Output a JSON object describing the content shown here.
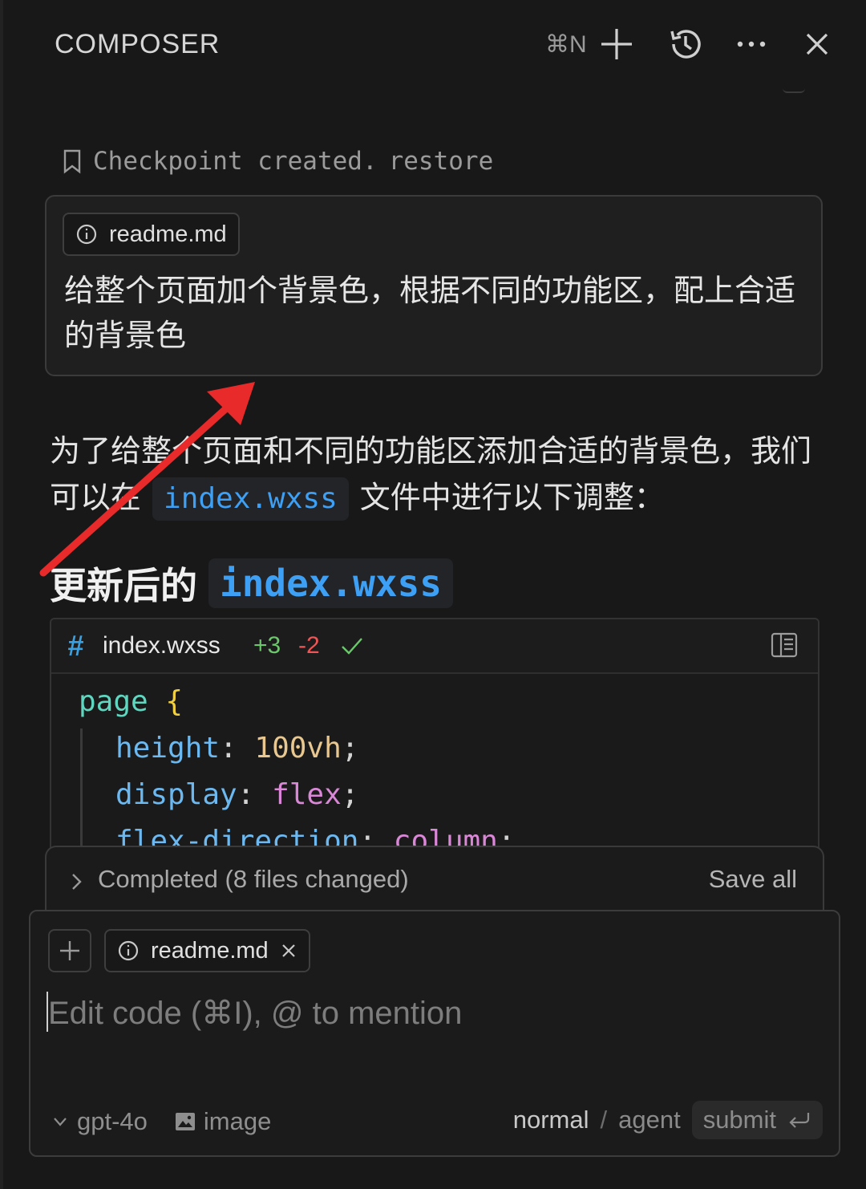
{
  "header": {
    "title": "COMPOSER",
    "shortcut": "⌘N"
  },
  "checkpoint": {
    "text": "Checkpoint created.",
    "restore": "restore"
  },
  "user_message": {
    "attachment": "readme.md",
    "text": "给整个页面加个背景色，根据不同的功能区，配上合适的背景色"
  },
  "assistant": {
    "para_before": "为了给整个页面和不同的功能区添加合适的背景色，我们可以在",
    "para_code": "index.wxss",
    "para_after": "文件中进行以下调整：",
    "heading_text": "更新后的",
    "heading_code": "index.wxss"
  },
  "code_block": {
    "lang_icon": "#",
    "filename": "index.wxss",
    "additions": "+3",
    "deletions": "-2",
    "lines": [
      {
        "sel": "page",
        "brace": "{"
      },
      {
        "prop": "height",
        "value": "100vh",
        "kind": "num"
      },
      {
        "prop": "display",
        "value": "flex",
        "kind": "kw"
      },
      {
        "prop": "flex-direction",
        "value": "column",
        "kind": "kw"
      }
    ]
  },
  "status_bar": {
    "text": "Completed (8 files changed)",
    "action": "Save all"
  },
  "input": {
    "attachment": "readme.md",
    "placeholder": "Edit code (⌘I), @ to mention",
    "model": "gpt-4o",
    "image_label": "image",
    "mode_normal": "normal",
    "mode_sep": "/",
    "mode_agent": "agent",
    "submit": "submit"
  },
  "colors": {
    "accent_blue": "#3ea0f5",
    "annotation_arrow": "#e82a2a",
    "additions": "#6cc76c",
    "deletions": "#f05555"
  }
}
